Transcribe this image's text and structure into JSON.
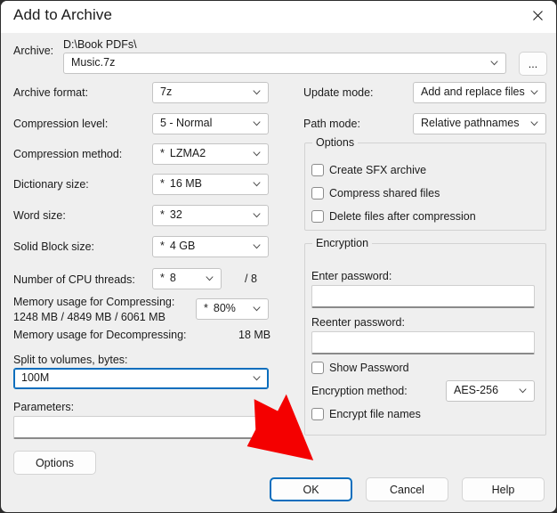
{
  "window": {
    "title": "Add to Archive",
    "close_icon": "close-icon"
  },
  "archive": {
    "label": "Archive:",
    "path": "D:\\Book PDFs\\",
    "filename": "Music.7z",
    "browse_label": "..."
  },
  "left_column": {
    "archive_format": {
      "label": "Archive format:",
      "value": "7z",
      "starred": false
    },
    "compression_level": {
      "label": "Compression level:",
      "value": "5 - Normal",
      "starred": false
    },
    "compression_method": {
      "label": "Compression method:",
      "value": "LZMA2",
      "starred": true
    },
    "dictionary_size": {
      "label": "Dictionary size:",
      "value": "16 MB",
      "starred": true
    },
    "word_size": {
      "label": "Word size:",
      "value": "32",
      "starred": true
    },
    "solid_block_size": {
      "label": "Solid Block size:",
      "value": "4 GB",
      "starred": true
    },
    "cpu_threads": {
      "label": "Number of CPU threads:",
      "value": "8",
      "starred": true,
      "total": "/ 8"
    },
    "memory_compressing": {
      "label": "Memory usage for Compressing:",
      "values": "1248 MB / 4849 MB / 6061 MB",
      "percent": "80%",
      "percent_starred": true
    },
    "memory_decompressing": {
      "label": "Memory usage for Decompressing:",
      "value": "18 MB"
    },
    "split_volumes": {
      "label": "Split to volumes, bytes:",
      "value": "100M",
      "focused": true
    },
    "parameters": {
      "label": "Parameters:",
      "value": ""
    },
    "options_button": "Options"
  },
  "right_column": {
    "update_mode": {
      "label": "Update mode:",
      "value": "Add and replace files"
    },
    "path_mode": {
      "label": "Path mode:",
      "value": "Relative pathnames"
    },
    "options_group": {
      "legend": "Options",
      "checkboxes": [
        {
          "label": "Create SFX archive",
          "checked": false
        },
        {
          "label": "Compress shared files",
          "checked": false
        },
        {
          "label": "Delete files after compression",
          "checked": false
        }
      ]
    },
    "encryption_group": {
      "legend": "Encryption",
      "enter_password_label": "Enter password:",
      "enter_password_value": "",
      "reenter_password_label": "Reenter password:",
      "reenter_password_value": "",
      "show_password": {
        "label": "Show Password",
        "checked": false
      },
      "encryption_method": {
        "label": "Encryption method:",
        "value": "AES-256"
      },
      "encrypt_file_names": {
        "label": "Encrypt file names",
        "checked": false
      }
    }
  },
  "footer": {
    "ok": "OK",
    "cancel": "Cancel",
    "help": "Help"
  },
  "annotation": {
    "arrow_icon": "red-arrow-pointing-to-ok",
    "color": "#f40000"
  },
  "colors": {
    "dialog_bg": "#efefef",
    "titlebar_bg": "#ffffff",
    "accent": "#0a6ebd",
    "field_bg": "#ffffff",
    "border": "#c4c4c4"
  }
}
